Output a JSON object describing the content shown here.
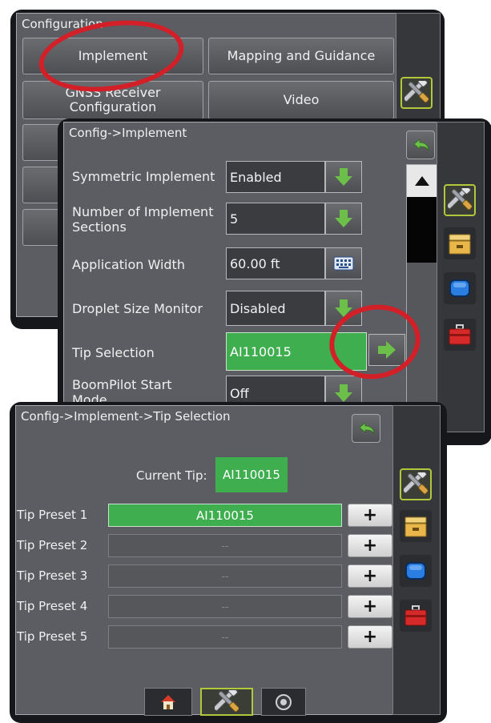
{
  "screen1": {
    "title": "Configuration",
    "buttons": [
      "Implement",
      "Mapping and Guidance",
      "GNSS Receiver Configuration",
      "Video"
    ]
  },
  "screen2": {
    "title": "Config->Implement",
    "rows": [
      {
        "label": "Symmetric Implement",
        "value": "Enabled",
        "control": "arrow-down"
      },
      {
        "label": "Number of Implement Sections",
        "value": "5",
        "control": "arrow-down"
      },
      {
        "label": "Application Width",
        "value": "60.00 ft",
        "control": "keyboard"
      },
      {
        "label": "Droplet Size Monitor",
        "value": "Disabled",
        "control": "arrow-down"
      },
      {
        "label": "Tip Selection",
        "value": "AI110015",
        "control": "arrow-right"
      },
      {
        "label": "BoomPilot Start Mode",
        "value": "Off",
        "control": "arrow-down"
      }
    ]
  },
  "screen3": {
    "title": "Config->Implement->Tip Selection",
    "current_tip_label": "Current Tip:",
    "current_tip_value": "AI110015",
    "presets": [
      {
        "label": "Tip Preset 1",
        "value": "AI110015"
      },
      {
        "label": "Tip Preset 2",
        "value": "--"
      },
      {
        "label": "Tip Preset 3",
        "value": "--"
      },
      {
        "label": "Tip Preset 4",
        "value": "--"
      },
      {
        "label": "Tip Preset 5",
        "value": "--"
      }
    ],
    "plus_label": "+"
  },
  "icons": {
    "tools": "tools-icon",
    "storage": "data-storage-icon",
    "console": "console-icon",
    "toolbox": "toolbox-icon",
    "back": "back-arrow-icon",
    "home": "home-icon",
    "camera": "camera-icon"
  },
  "colors": {
    "active_green": "#3fae4f",
    "arrow_green": "#6cc04a",
    "annotation_red": "#d31f27",
    "tab_highlight": "#b2c73c"
  }
}
